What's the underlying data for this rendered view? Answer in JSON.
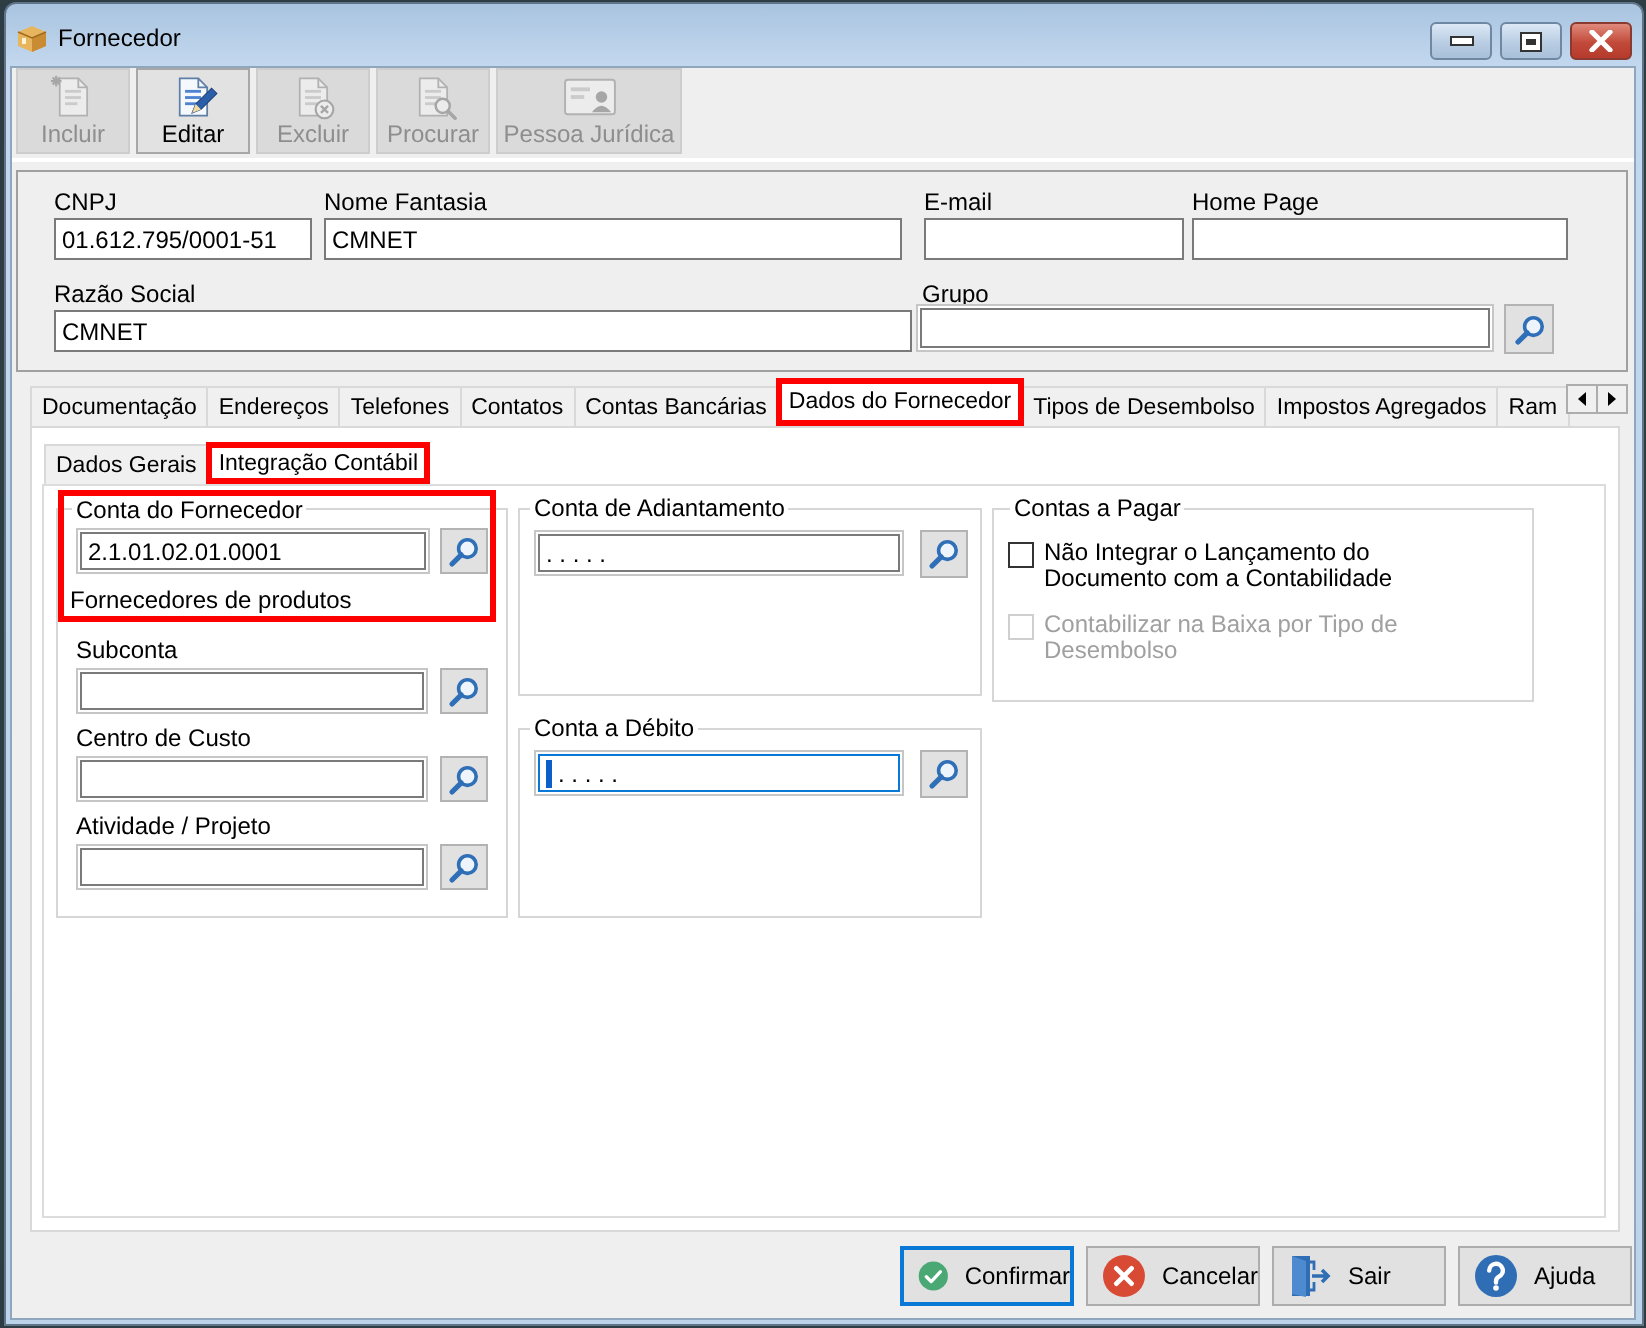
{
  "window": {
    "title": "Fornecedor"
  },
  "toolbar": [
    {
      "kind": "new",
      "label": "Incluir",
      "disabled": true
    },
    {
      "kind": "edit",
      "label": "Editar",
      "disabled": false
    },
    {
      "kind": "delete",
      "label": "Excluir",
      "disabled": true
    },
    {
      "kind": "find",
      "label": "Procurar",
      "disabled": true
    },
    {
      "kind": "company",
      "label": "Pessoa Jurídica",
      "disabled": true
    }
  ],
  "header": {
    "fields": [
      {
        "label": "CNPJ",
        "value": "01.612.795/0001-51"
      },
      {
        "label": "Nome Fantasia",
        "value": "CMNET"
      },
      {
        "label": "E-mail"
      },
      {
        "label": "Home Page"
      },
      {
        "label": "Razão Social",
        "value": "CMNET"
      },
      {
        "label": "Grupo",
        "lookup": true
      }
    ]
  },
  "tabs": [
    {
      "label": "Documentação",
      "selected": false,
      "highlighted": false
    },
    {
      "label": "Endereços",
      "selected": false,
      "highlighted": false
    },
    {
      "label": "Telefones",
      "selected": false,
      "highlighted": false
    },
    {
      "label": "Contatos",
      "selected": false,
      "highlighted": false
    },
    {
      "label": "Contas Bancárias",
      "selected": false,
      "highlighted": false
    },
    {
      "label": "Dados do Fornecedor",
      "selected": true,
      "highlighted": true
    },
    {
      "label": "Tipos de Desembolso",
      "selected": false,
      "highlighted": false
    },
    {
      "label": "Impostos Agregados",
      "selected": false,
      "highlighted": false
    },
    {
      "label": "Ram",
      "selected": false,
      "highlighted": false
    }
  ],
  "subtabs": [
    {
      "label": "Dados Gerais",
      "selected": false,
      "highlighted": false
    },
    {
      "label": "Integração Contábil",
      "selected": true,
      "highlighted": true
    }
  ],
  "supplier_account": {
    "legend": "Conta do Fornecedor",
    "highlighted": true,
    "value": "2.1.01.02.01.0001",
    "description": "Fornecedores de produtos",
    "fields": [
      {
        "label": "Subconta"
      },
      {
        "label": "Centro de Custo"
      },
      {
        "label": "Atividade / Projeto"
      }
    ]
  },
  "advance_account": {
    "legend": "Conta de Adiantamento",
    "value": ". . . . .",
    "focused": false
  },
  "debit_account": {
    "legend": "Conta a Débito",
    "value": ". . . . .",
    "focused": true
  },
  "payables": {
    "legend": "Contas a Pagar",
    "options": [
      {
        "label": "Não Integrar o Lançamento do Documento com a Contabilidade",
        "checked": false,
        "disabled": false
      },
      {
        "label": "Contabilizar na Baixa por Tipo de Desembolso",
        "checked": false,
        "disabled": true
      }
    ]
  },
  "buttons": [
    {
      "kind": "confirm",
      "label": "Confirmar",
      "focused": true
    },
    {
      "kind": "cancel",
      "label": "Cancelar",
      "focused": false
    },
    {
      "kind": "exit",
      "label": "Sair",
      "focused": false
    },
    {
      "kind": "help",
      "label": "Ajuda",
      "focused": false
    }
  ]
}
